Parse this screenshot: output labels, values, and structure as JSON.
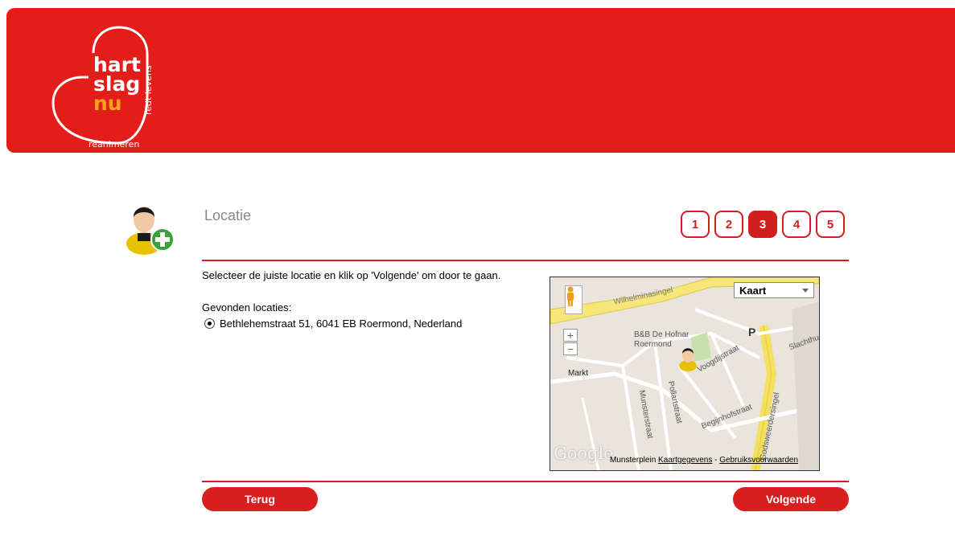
{
  "logo": {
    "line1": "hart",
    "line2": "slag",
    "line3": "nu",
    "tagline": "redt levens",
    "subtitle": "reanimeren"
  },
  "page": {
    "title": "Locatie"
  },
  "steps": [
    "1",
    "2",
    "3",
    "4",
    "5"
  ],
  "active_step": "3",
  "content": {
    "instruction": "Selecteer de juiste locatie en klik op 'Volgende' om door te gaan.",
    "found_label": "Gevonden locaties:",
    "location": "Bethlehemstraat 51, 6041 EB Roermond, Nederland"
  },
  "map": {
    "type_label": "Kaart",
    "zoom_in": "+",
    "zoom_out": "−",
    "google": "Google",
    "footer_left": "Munsterplein",
    "footer_data": "Kaartgegevens",
    "footer_sep": " - ",
    "footer_terms": "Gebruiksvoorwaarden",
    "labels": {
      "wilhelminasingel": "Wilhelminasingel",
      "bnb": "B&B De Hofnar",
      "roermond": "Roermond",
      "markt": "Markt",
      "voogdijstraat": "Voogdijstraat",
      "slachthuis": "Slachthu",
      "godsweerdersingel": "Godsweerdersingel",
      "munsterstraat": "Munsterstraat",
      "pollartstraat": "Pollartstraat",
      "begijnhofstraat": "Begijnhofstraat",
      "parking": "P"
    }
  },
  "buttons": {
    "back": "Terug",
    "next": "Volgende"
  },
  "colors": {
    "brand_red": "#e31d1a",
    "button_red": "#d81e1e",
    "accent_orange": "#f7a21b"
  }
}
